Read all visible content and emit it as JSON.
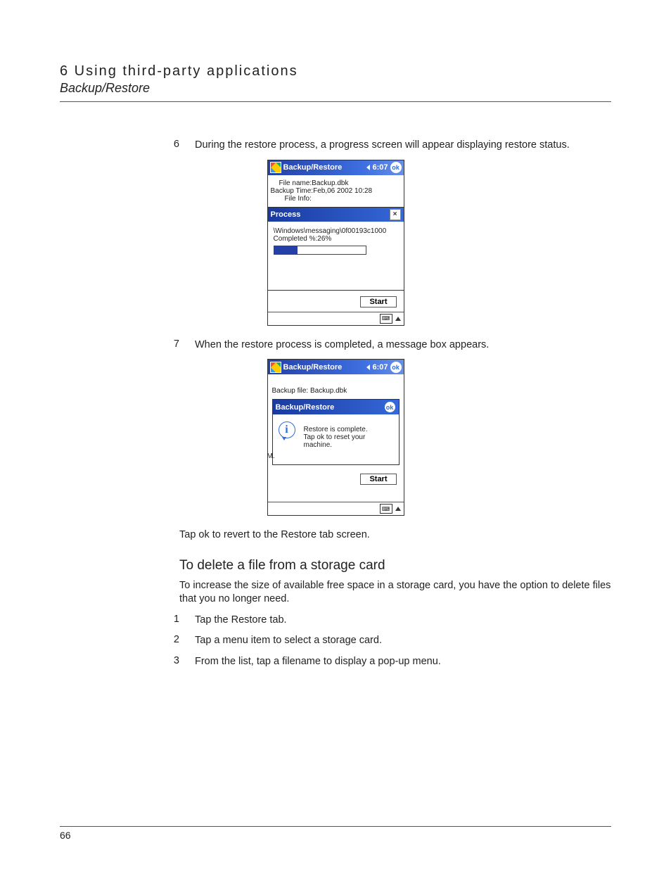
{
  "header": {
    "chapter": "6 Using third-party applications",
    "section": "Backup/Restore"
  },
  "body": {
    "step6_num": "6",
    "step6_text": "During the restore process, a progress screen will appear displaying restore status.",
    "step7_num": "7",
    "step7_text": "When the restore process is completed, a message box appears.",
    "post7": "Tap ok to revert to the Restore tab screen.",
    "subheading": "To delete a file from a storage card",
    "subtext": "To increase the size of available free space in a storage card, you have the option to delete files that you no longer need.",
    "d1_num": "1",
    "d1_text": "Tap the Restore tab.",
    "d2_num": "2",
    "d2_text": "Tap a menu item to select a storage card.",
    "d3_num": "3",
    "d3_text": "From the list, tap a filename to display a pop-up menu."
  },
  "fig1": {
    "title": "Backup/Restore",
    "time": "6:07",
    "ok": "ok",
    "line1": "File name:Backup.dbk",
    "line2": "Backup Time:Feb,06 2002  10:28",
    "line3": "File Info:",
    "process_title": "Process",
    "path": "\\Windows\\messaging\\0f00193c1000",
    "completed": "Completed %:26%",
    "start": "Start"
  },
  "fig2": {
    "title": "Backup/Restore",
    "time": "6:07",
    "ok": "ok",
    "line1": "Backup file: Backup.dbk",
    "dlg_title": "Backup/Restore",
    "dlg_ok": "ok",
    "info_glyph": "i",
    "msg1": "Restore is complete.",
    "msg2": "Tap ok to reset your",
    "msg3": "machine.",
    "left_m": "M.",
    "start": "Start"
  },
  "pagenum": "66"
}
